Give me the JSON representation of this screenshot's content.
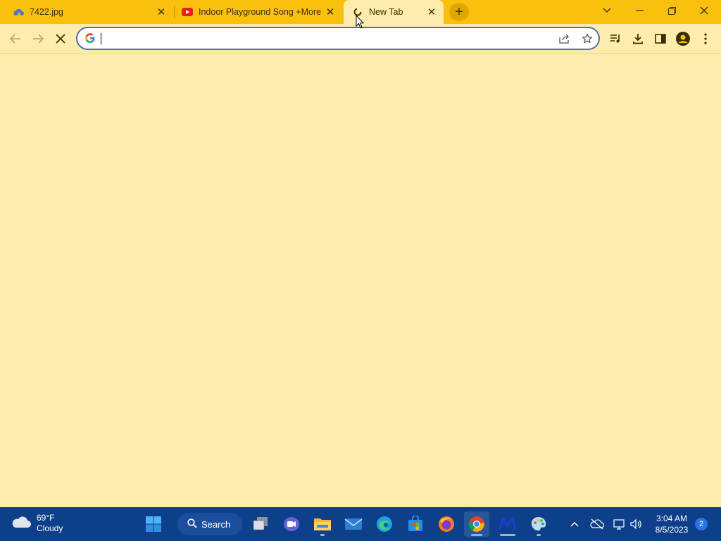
{
  "browser": {
    "tabs": [
      {
        "title": "7422.jpg",
        "favicon": "cloud-icon",
        "active": false
      },
      {
        "title": "Indoor Playground Song +More",
        "favicon": "youtube-icon",
        "active": false
      },
      {
        "title": "New Tab",
        "favicon": "loading-icon",
        "active": true
      }
    ],
    "omnibox": {
      "value": "",
      "placeholder": ""
    },
    "theme_color": "#f9c10d",
    "page_background": "#fdecab"
  },
  "taskbar": {
    "weather": {
      "temp": "69°F",
      "condition": "Cloudy"
    },
    "search_label": "Search",
    "clock": {
      "time": "3:04 AM",
      "date": "8/5/2023"
    },
    "notification_count": "2",
    "background": "#0d3f8a"
  }
}
